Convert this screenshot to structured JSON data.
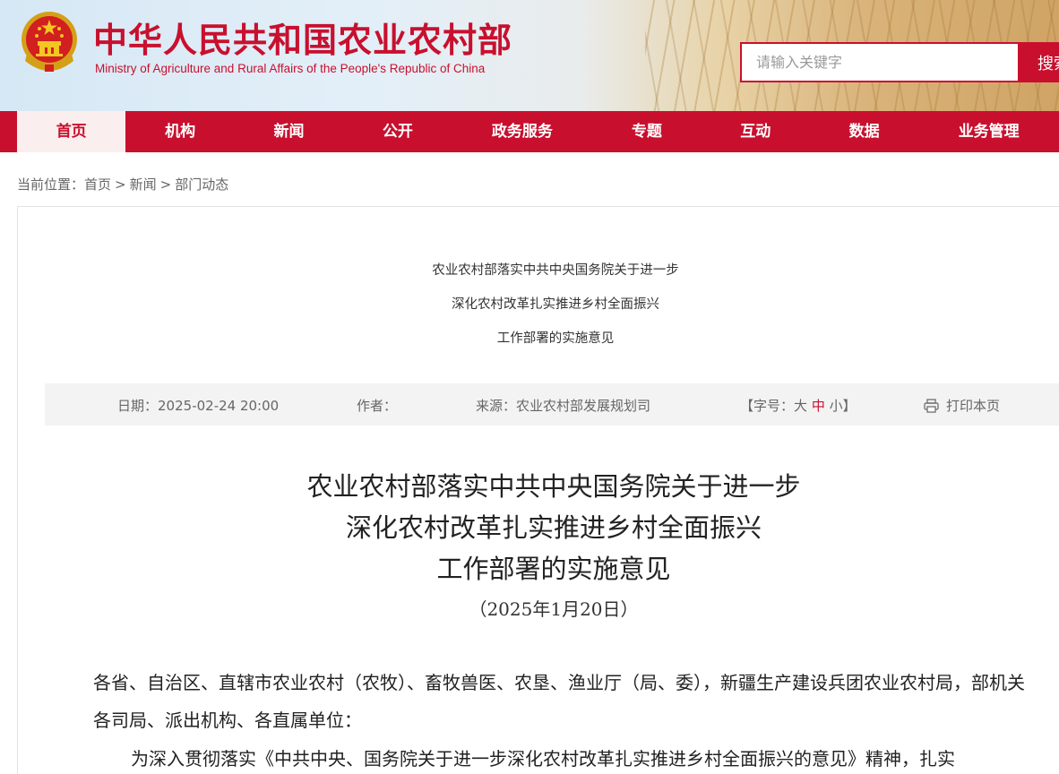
{
  "header": {
    "title": "中华人民共和国农业农村部",
    "subtitle": "Ministry of Agriculture and Rural Affairs of the People's Republic of China",
    "search_placeholder": "请输入关键字",
    "search_button": "搜索"
  },
  "nav": {
    "items": [
      "首页",
      "机构",
      "新闻",
      "公开",
      "政务服务",
      "专题",
      "互动",
      "数据",
      "业务管理"
    ],
    "active": "首页"
  },
  "breadcrumb": {
    "prefix": "当前位置：",
    "items": [
      "首页",
      "新闻",
      "部门动态"
    ],
    "separator": ">"
  },
  "article": {
    "top_title_lines": [
      "农业农村部落实中共中央国务院关于进一步",
      "深化农村改革扎实推进乡村全面振兴",
      "工作部署的实施意见"
    ],
    "meta": {
      "date_label": "日期：",
      "date_value": "2025-02-24 20:00",
      "author_label": "作者：",
      "source_label": "来源：",
      "source_value": "农业农村部发展规划司",
      "font_size_label": "【字号：",
      "font_large": "大",
      "font_medium": "中",
      "font_small": "小",
      "font_close": "】",
      "print_label": "打印本页"
    },
    "main_title_lines": [
      "农业农村部落实中共中央国务院关于进一步",
      "深化农村改革扎实推进乡村全面振兴",
      "工作部署的实施意见"
    ],
    "date_line": "（2025年1月20日）",
    "paragraphs": [
      "各省、自治区、直辖市农业农村（农牧）、畜牧兽医、农垦、渔业厅（局、委），新疆生产建设兵团农业农村局，部机关各司局、派出机构、各直属单位：",
      "为深入贯彻落实《中共中央、国务院关于进一步深化农村改革扎实推进乡村全面振兴的意见》精神，扎实"
    ]
  },
  "colors": {
    "brand_red": "#c8102e",
    "meta_bg": "#f3f3f3"
  }
}
